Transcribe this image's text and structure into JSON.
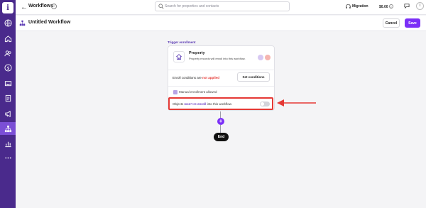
{
  "sidebar": {
    "logo_letter": "i",
    "items": [
      {
        "icon": "globe-icon"
      },
      {
        "icon": "home-icon"
      },
      {
        "icon": "contacts-icon"
      },
      {
        "icon": "dollar-icon"
      },
      {
        "icon": "inbox-icon"
      },
      {
        "icon": "document-icon"
      },
      {
        "icon": "megaphone-icon"
      },
      {
        "icon": "workflow-icon",
        "active": true
      },
      {
        "icon": "reports-icon"
      },
      {
        "icon": "more-icon"
      }
    ]
  },
  "topbar": {
    "breadcrumb": "Workflows",
    "search_placeholder": "Search for properties and contacts",
    "migration_label": "Migration",
    "credit_label": "$0.00",
    "avatar_initial": "I"
  },
  "header": {
    "title": "Untitled Workflow",
    "cancel_label": "Cancel",
    "save_label": "Save"
  },
  "canvas": {
    "trigger_label": "Trigger enrollment",
    "trigger": {
      "title": "Property",
      "description": "Property records will enroll into this workflow.",
      "enroll_prefix": "Enroll conditions are ",
      "enroll_status": "not applied",
      "set_conditions_label": "Set conditions",
      "manual_enrollment_label": "Manual enrollment allowed",
      "reenroll_prefix": "Objects ",
      "reenroll_highlight": "won't re-enroll",
      "reenroll_suffix": " into this workflow."
    },
    "end_label": "End"
  },
  "colors": {
    "sidebar_bg": "#4a2a8c",
    "accent": "#7b2ff7",
    "warning": "#e53935",
    "annotation": "#e53935"
  }
}
